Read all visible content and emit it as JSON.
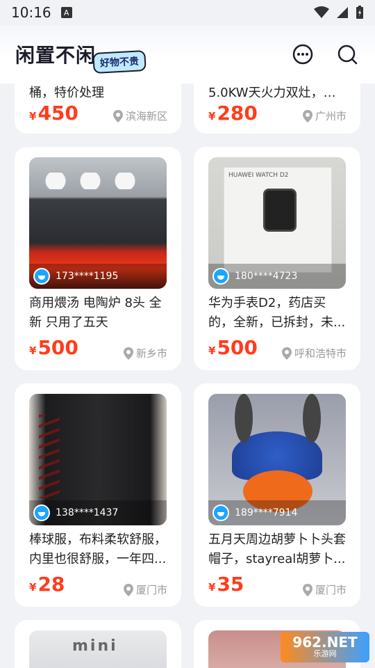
{
  "status": {
    "time": "10:16",
    "notif": "A"
  },
  "header": {
    "title": "闲置不闲",
    "tag": "好物不贵"
  },
  "cards": [
    {
      "title": "桶，特价处理",
      "price": "450",
      "location": "滨海新区"
    },
    {
      "title": "5.0KW天火力双灶，型...",
      "price": "280",
      "location": "广州市"
    },
    {
      "title": "商用煨汤 电陶炉  8头 全新 只用了五天",
      "price": "500",
      "location": "新乡市",
      "user": "173****1195"
    },
    {
      "title": "华为手表D2，药店买的，全新，已拆封，未...",
      "price": "500",
      "location": "呼和浩特市",
      "user": "180****4723"
    },
    {
      "title": "棒球服，布料柔软舒服，内里也很舒服，一年四...",
      "price": "28",
      "location": "厦门市",
      "user": "138****1437"
    },
    {
      "title": "五月天周边胡萝卜卜头套帽子，stayreal胡萝卜...",
      "price": "35",
      "location": "厦门市",
      "user": "189****7914"
    }
  ],
  "currency": "¥",
  "watermark": {
    "line1": "962.NET",
    "line2": "乐游网"
  },
  "thumb_texts": {
    "watch_brand": "HUAWEI WATCH D2",
    "cup_brand": "mini"
  },
  "colors": {
    "price": "#ff3c1c",
    "accent": "#1aa6ff"
  }
}
